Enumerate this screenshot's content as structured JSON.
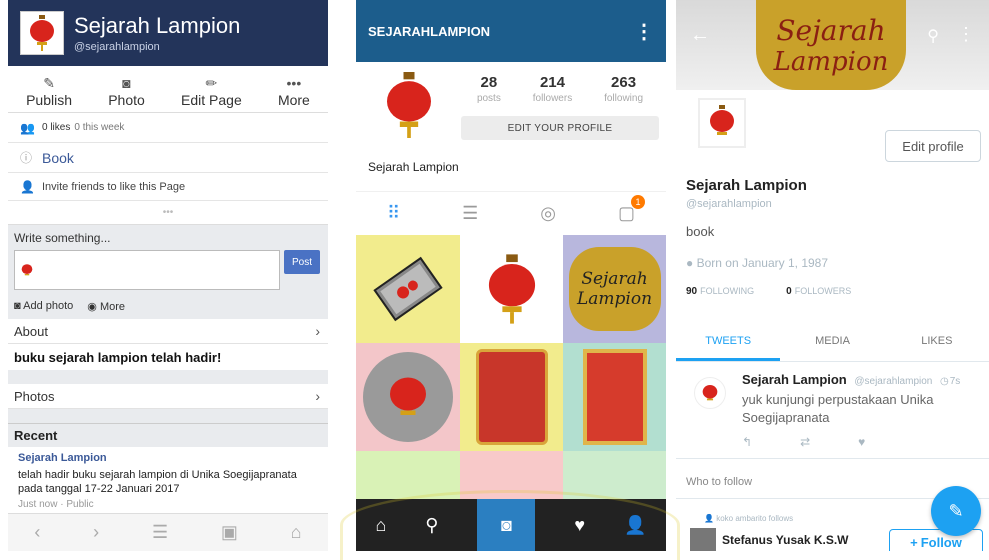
{
  "facebook": {
    "title": "Sejarah Lampion",
    "handle": "@sejarahlampion",
    "actions": [
      {
        "icon": "edit-icon",
        "label": "Publish"
      },
      {
        "icon": "camera-icon",
        "label": "Photo"
      },
      {
        "icon": "pencil-icon",
        "label": "Edit Page"
      },
      {
        "icon": "more-icon",
        "label": "More"
      }
    ],
    "likes_count": "0 likes",
    "likes_week": "0 this week",
    "category": "Book",
    "invite": "Invite friends to like this Page",
    "write_label": "Write something...",
    "post_button": "Post",
    "add_photo": "Add photo",
    "more": "More",
    "about_label": "About",
    "announcement": "buku sejarah lampion telah hadir!",
    "photos_label": "Photos",
    "recent_label": "Recent",
    "post": {
      "author": "Sejarah Lampion",
      "text": "telah hadir buku sejarah lampion di Unika Soegijapranata pada tanggal 17-22 Januari 2017",
      "meta": "Just now · Public"
    }
  },
  "instagram": {
    "username": "SEJARAHLAMPION",
    "stats": [
      {
        "value": "28",
        "label": "posts"
      },
      {
        "value": "214",
        "label": "followers"
      },
      {
        "value": "263",
        "label": "following"
      }
    ],
    "edit_profile": "EDIT YOUR PROFILE",
    "display_name": "Sejarah Lampion",
    "notification_count": "1",
    "tile_logo_line1": "Sejarah",
    "tile_logo_line2": "Lampion"
  },
  "twitter": {
    "banner_line1": "Sejarah",
    "banner_line2": "Lampion",
    "edit_profile": "Edit profile",
    "name": "Sejarah Lampion",
    "handle": "@sejarahlampion",
    "bio": "book",
    "born": "Born on January 1, 1987",
    "following_count": "90",
    "following_label": "FOLLOWING",
    "followers_count": "0",
    "followers_label": "FOLLOWERS",
    "tabs": [
      "TWEETS",
      "MEDIA",
      "LIKES"
    ],
    "tweet": {
      "name": "Sejarah Lampion",
      "handle": "@sejarahlampion",
      "time": "7s",
      "text": "yuk kunjungi perpustakaan Unika Soegijapranata"
    },
    "who_to_follow": "Who to follow",
    "suggestion_note": "koko ambarito follows",
    "suggestion_name": "Stefanus Yusak K.S.W",
    "follow_button": "Follow"
  },
  "colors": {
    "facebook_blue": "#23345a",
    "instagram_blue": "#1c5d8c",
    "twitter_blue": "#1da1f2",
    "lantern_red": "#d8241c"
  }
}
